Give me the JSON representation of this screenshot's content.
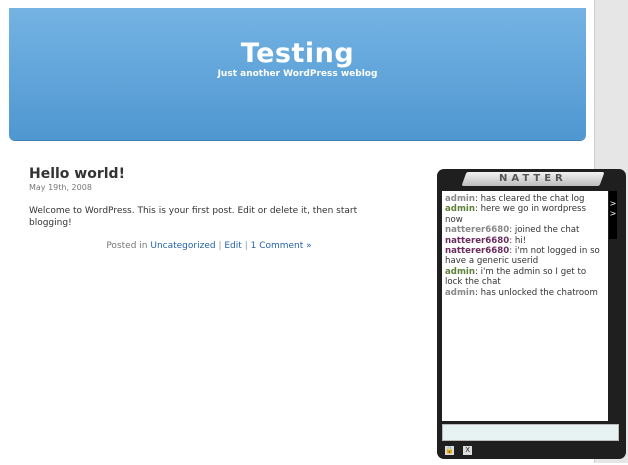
{
  "site": {
    "title": "Testing",
    "tagline": "Just another WordPress weblog"
  },
  "post": {
    "title": "Hello world!",
    "date": "May 19th, 2008",
    "body": "Welcome to WordPress. This is your first post. Edit or delete it, then start blogging!",
    "meta": {
      "posted_in": "Posted in",
      "category": "Uncategorized",
      "edit": "Edit",
      "comments": "1 Comment »",
      "separator": "|"
    }
  },
  "chat": {
    "logo": "NATTER",
    "scroll_arrow": "> >",
    "messages": [
      {
        "name": "admin",
        "text": ": has cleared the chat log",
        "style": "grey"
      },
      {
        "name": "admin",
        "text": ": here we go in wordpress now",
        "style": "green"
      },
      {
        "name": "natterer6680",
        "text": ": joined the chat",
        "style": "grey"
      },
      {
        "name": "natterer6680",
        "text": ": hi!",
        "style": "purple"
      },
      {
        "name": "natterer6680",
        "text": ": i'm not logged in so have a generic userid",
        "style": "purple"
      },
      {
        "name": "admin",
        "text": ": i'm the admin so I get to lock the chat",
        "style": "green"
      },
      {
        "name": "admin",
        "text": ": has unlocked the chatroom",
        "style": "grey"
      }
    ],
    "input_value": "",
    "icons": {
      "lock": "lock-icon",
      "close_label": "X"
    }
  }
}
